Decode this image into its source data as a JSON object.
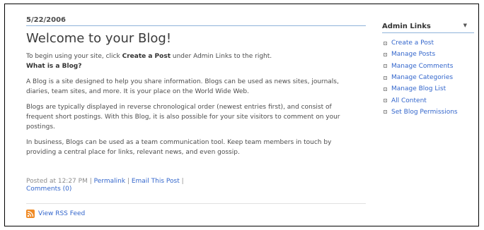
{
  "post": {
    "date": "5/22/2006",
    "title": "Welcome to your Blog!",
    "intro_prefix": "To begin using your site, click ",
    "intro_link": "Create a Post",
    "intro_suffix": " under Admin Links to the right.",
    "question": "What is a Blog?",
    "paragraphs": [
      "A Blog is a site designed to help you share information. Blogs can be used as news sites, journals, diaries, team sites, and more. It is your place on the World Wide Web.",
      "Blogs are typically displayed in reverse chronological order (newest entries first), and consist of frequent short postings. With this Blog, it is also possible for your site visitors to comment on your postings.",
      "In business, Blogs can be used as a team communication tool. Keep team members in touch by providing a central place for links, relevant news, and even gossip."
    ],
    "posted_at": "Posted at 12:27 PM",
    "separator": "|",
    "permalink": "Permalink",
    "email": "Email This Post",
    "comments": "Comments (0)"
  },
  "rss": {
    "label": "View RSS Feed",
    "icon": "rss-icon"
  },
  "sidebar": {
    "title": "Admin Links",
    "arrow": "▼",
    "items": [
      {
        "label": "Create a Post"
      },
      {
        "label": "Manage Posts"
      },
      {
        "label": "Manage Comments"
      },
      {
        "label": "Manage Categories"
      },
      {
        "label": "Manage Blog List"
      },
      {
        "label": "All Content"
      },
      {
        "label": "Set Blog Permissions"
      }
    ]
  }
}
